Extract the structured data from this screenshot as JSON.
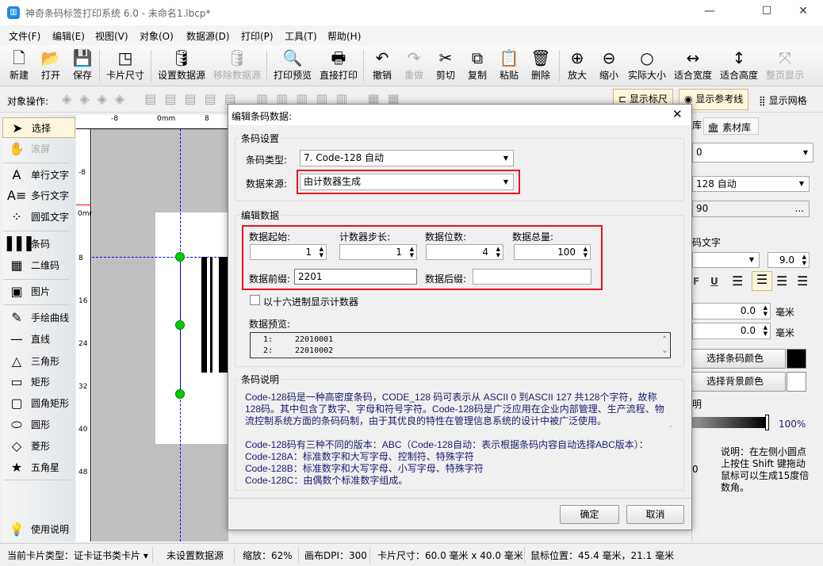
{
  "window": {
    "title": "神奇条码标签打印系统 6.0 - 未命名1.lbcp*",
    "minimize": "—",
    "maximize": "☐",
    "close": "✕"
  },
  "menu": [
    "文件(F)",
    "编辑(E)",
    "视图(V)",
    "对象(O)",
    "数据源(D)",
    "打印(P)",
    "工具(T)",
    "帮助(H)"
  ],
  "toolbar": [
    {
      "label": "新建",
      "icon": "new-file-icon",
      "glyph": "🗋",
      "enabled": true
    },
    {
      "label": "打开",
      "icon": "open-icon",
      "glyph": "📂",
      "enabled": true
    },
    {
      "label": "保存",
      "icon": "save-icon",
      "glyph": "💾",
      "enabled": true
    },
    {
      "label": "卡片尺寸",
      "icon": "card-size-icon",
      "glyph": "◳",
      "enabled": true
    },
    {
      "label": "设置数据源",
      "icon": "database-icon",
      "glyph": "🛢",
      "enabled": true
    },
    {
      "label": "移除数据源",
      "icon": "remove-database-icon",
      "glyph": "🛢",
      "enabled": false
    },
    {
      "label": "打印预览",
      "icon": "print-preview-icon",
      "glyph": "🔍",
      "enabled": true
    },
    {
      "label": "直接打印",
      "icon": "printer-icon",
      "glyph": "🖶",
      "enabled": true
    },
    {
      "label": "撤销",
      "icon": "undo-icon",
      "glyph": "↶",
      "enabled": true
    },
    {
      "label": "重做",
      "icon": "redo-icon",
      "glyph": "↷",
      "enabled": false
    },
    {
      "label": "剪切",
      "icon": "scissors-icon",
      "glyph": "✂",
      "enabled": true
    },
    {
      "label": "复制",
      "icon": "copy-icon",
      "glyph": "⧉",
      "enabled": true
    },
    {
      "label": "粘贴",
      "icon": "paste-icon",
      "glyph": "📋",
      "enabled": true
    },
    {
      "label": "删除",
      "icon": "trash-icon",
      "glyph": "🗑",
      "enabled": true
    },
    {
      "label": "放大",
      "icon": "zoom-in-icon",
      "glyph": "⊕",
      "enabled": true
    },
    {
      "label": "缩小",
      "icon": "zoom-out-icon",
      "glyph": "⊖",
      "enabled": true
    },
    {
      "label": "实际大小",
      "icon": "actual-size-icon",
      "glyph": "○",
      "enabled": true
    },
    {
      "label": "适合宽度",
      "icon": "fit-width-icon",
      "glyph": "↔",
      "enabled": true
    },
    {
      "label": "适合高度",
      "icon": "fit-height-icon",
      "glyph": "↕",
      "enabled": true
    },
    {
      "label": "整页显示",
      "icon": "fit-page-icon",
      "glyph": "⤧",
      "enabled": false
    }
  ],
  "optoolbar": {
    "label": "对象操作:",
    "show_ruler": "显示标尺",
    "show_guides": "显示参考线",
    "show_grid": "显示网格"
  },
  "tools": [
    {
      "label": "选择",
      "icon": "cursor-icon",
      "glyph": "➤",
      "selected": true
    },
    {
      "label": "滚屏",
      "icon": "hand-icon",
      "glyph": "✋",
      "disabled": true
    },
    {
      "label": "单行文字",
      "icon": "single-line-text-icon",
      "glyph": "A"
    },
    {
      "label": "多行文字",
      "icon": "multi-line-text-icon",
      "glyph": "A≡"
    },
    {
      "label": "圆弧文字",
      "icon": "arc-text-icon",
      "glyph": "⁘"
    },
    {
      "label": "条码",
      "icon": "barcode-icon",
      "glyph": "▌▌▌"
    },
    {
      "label": "二维码",
      "icon": "qrcode-icon",
      "glyph": "▦"
    },
    {
      "label": "图片",
      "icon": "image-icon",
      "glyph": "▣"
    },
    {
      "label": "手绘曲线",
      "icon": "pen-icon",
      "glyph": "✎"
    },
    {
      "label": "直线",
      "icon": "line-icon",
      "glyph": "—"
    },
    {
      "label": "三角形",
      "icon": "triangle-icon",
      "glyph": "△"
    },
    {
      "label": "矩形",
      "icon": "rectangle-icon",
      "glyph": "▭"
    },
    {
      "label": "圆角矩形",
      "icon": "rounded-rectangle-icon",
      "glyph": "▢"
    },
    {
      "label": "圆形",
      "icon": "ellipse-icon",
      "glyph": "⬭"
    },
    {
      "label": "菱形",
      "icon": "diamond-icon",
      "glyph": "◇"
    },
    {
      "label": "五角星",
      "icon": "star-icon",
      "glyph": "★"
    }
  ],
  "help": "使用说明",
  "rulers": {
    "h": [
      "-8",
      "0mm",
      "8"
    ],
    "v": [
      "-8",
      "0mm",
      "8",
      "16",
      "24",
      "32",
      "40",
      "48"
    ]
  },
  "dialog": {
    "title": "编辑条码数据:",
    "barcode_settings": "条码设置",
    "type_label": "条码类型:",
    "type_value": "7. Code-128 自动",
    "source_label": "数据来源:",
    "source_value": "由计数器生成",
    "edit_data": "编辑数据",
    "start_label": "数据起始:",
    "start_value": "1",
    "step_label": "计数器步长:",
    "step_value": "1",
    "digits_label": "数据位数:",
    "digits_value": "4",
    "total_label": "数据总量:",
    "total_value": "100",
    "prefix_label": "数据前缀:",
    "prefix_value": "2201",
    "suffix_label": "数据后缀:",
    "suffix_value": "",
    "hex_label": "以十六进制显示计数器",
    "preview_label": "数据预览:",
    "preview": [
      {
        "n": "1:",
        "v": "22010001"
      },
      {
        "n": "2:",
        "v": "22010002"
      }
    ],
    "desc_title": "条码说明",
    "desc": [
      "Code-128码是一种高密度条码，CODE_128 码可表示从 ASCII 0 到ASCII 127 共128个字符，故称128码。其中包含了数字、字母和符号字符。Code-128码是广泛应用在企业内部管理、生产流程、物流控制系统方面的条码码制，由于其优良的特性在管理信息系统的设计中被广泛使用。",
      "",
      "Code-128码有三种不同的版本：ABC（Code-128自动：表示根据条码内容自动选择ABC版本）：",
      "Code-128A：标准数字和大写字母、控制符、特殊字符",
      "Code-128B：标准数字和大写字母、小写字母、特殊字符",
      "Code-128C：由偶数个标准数字组成。"
    ],
    "ok": "确定",
    "cancel": "取消"
  },
  "right": {
    "tab1": "库",
    "tab2": "素材库",
    "select1": "0",
    "select2": "128 自动",
    "data_field": "90",
    "more": "...",
    "text_label": "码文字",
    "font_size": "9.0",
    "italic": "F",
    "underline": "U",
    "offset1": "0.0",
    "offset2": "0.0",
    "unit": "毫米",
    "bar_color": "选择条码颜色",
    "bg_color": "选择背景颜色",
    "bar_color_hex": "#000000",
    "bg_color_hex": "#ffffff",
    "opacity_label": "明",
    "opacity": "100%",
    "angle": "0",
    "note": "说明：在左侧小圆点上按住 Shift 键拖动鼠标可以生成15度倍数角。"
  },
  "status": {
    "card_type": "当前卡片类型：证卡证书类卡片",
    "datasource": "未设置数据源",
    "zoom": "缩放：62%",
    "dpi": "画布DPI：300",
    "card_size": "卡片尺寸：60.0 毫米 x 40.0 毫米",
    "mouse": "鼠标位置：45.4 毫米，21.1 毫米"
  }
}
